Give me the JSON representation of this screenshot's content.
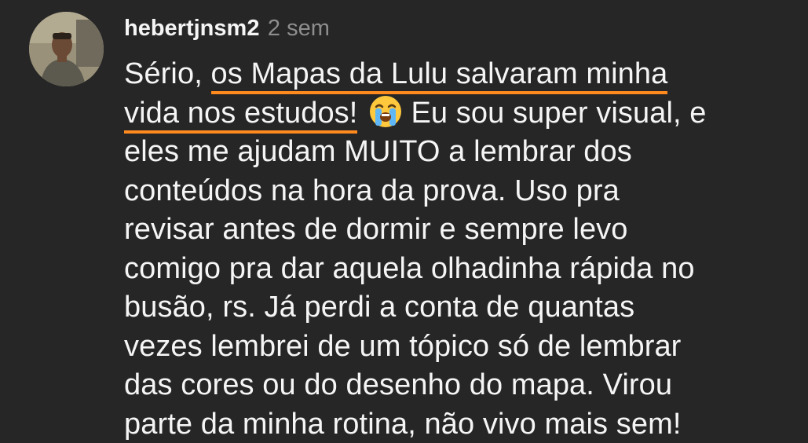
{
  "comment": {
    "username": "hebertjnsm2",
    "timestamp": "2 sem",
    "avatar_icon": "user-photo-avatar",
    "highlight_color": "#ff8a1e",
    "emoji": "loudly-crying-face",
    "lines": {
      "l1_plain": "Sério, ",
      "l1_highlight": "os Mapas da Lulu salvaram minha",
      "l2_highlight": "vida nos estudos!",
      "l2_rest": "Eu sou super visual, e",
      "l3": "eles me ajudam MUITO a lembrar dos",
      "l4": "conteúdos na hora da prova. Uso pra",
      "l5": "revisar antes de dormir e sempre levo",
      "l6": "comigo pra dar aquela olhadinha rápida no",
      "l7": "busão, rs. Já perdi a conta de quantas",
      "l8": "vezes lembrei de um tópico só de lembrar",
      "l9": "das cores ou do desenho do mapa. Virou",
      "l10": "parte da minha rotina, não vivo mais sem!"
    }
  }
}
